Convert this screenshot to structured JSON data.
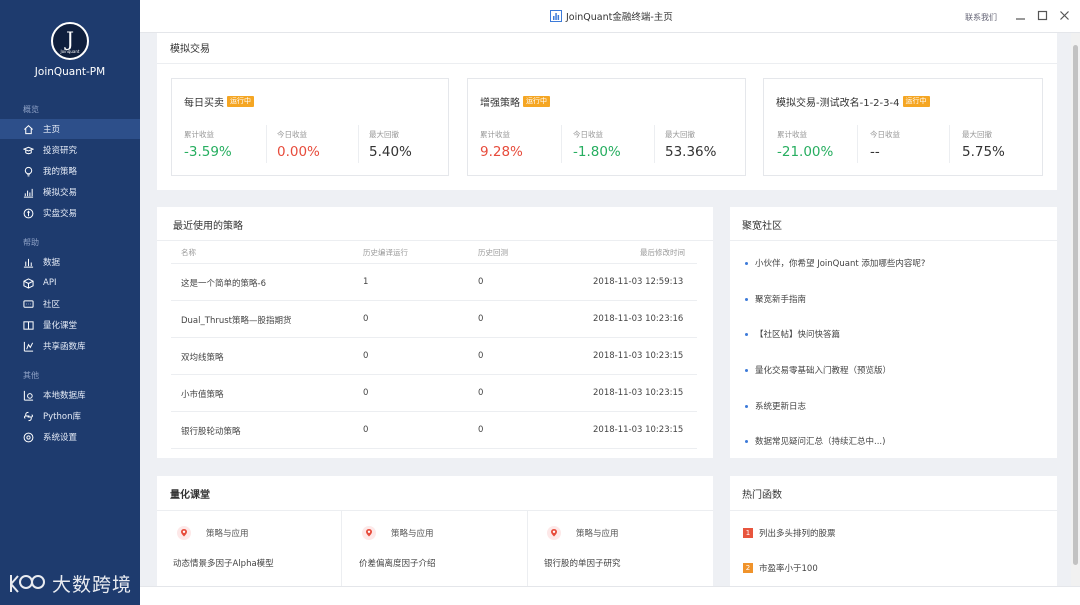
{
  "window": {
    "title": "JoinQuant金融终端-主页",
    "contact": "联系我们"
  },
  "sidebar": {
    "logo_letter": "J",
    "logo_sub": "Joinquant",
    "username": "JoinQuant-PM",
    "sections": [
      {
        "title": "概览",
        "items": [
          {
            "label": "主页",
            "icon": "home-icon"
          },
          {
            "label": "投资研究",
            "icon": "graduation-cap-icon"
          },
          {
            "label": "我的策略",
            "icon": "bulb-icon"
          },
          {
            "label": "模拟交易",
            "icon": "bar-chart-icon"
          },
          {
            "label": "实盘交易",
            "icon": "coin-icon"
          }
        ]
      },
      {
        "title": "帮助",
        "items": [
          {
            "label": "数据",
            "icon": "data-chart-icon"
          },
          {
            "label": "API",
            "icon": "cube-icon"
          },
          {
            "label": "社区",
            "icon": "chat-icon"
          },
          {
            "label": "量化课堂",
            "icon": "book-icon"
          },
          {
            "label": "共享函数库",
            "icon": "function-icon"
          }
        ]
      },
      {
        "title": "其他",
        "items": [
          {
            "label": "本地数据库",
            "icon": "database-icon"
          },
          {
            "label": "Python库",
            "icon": "python-icon"
          },
          {
            "label": "系统设置",
            "icon": "settings-icon"
          }
        ]
      }
    ],
    "watermark": "大数跨境"
  },
  "sim": {
    "title": "模拟交易",
    "cards": [
      {
        "name": "每日买卖",
        "status": "运行中",
        "metrics": [
          {
            "label": "累计收益",
            "value": "-3.59%",
            "color": "green"
          },
          {
            "label": "今日收益",
            "value": "0.00%",
            "color": "red"
          },
          {
            "label": "最大回撤",
            "value": "5.40%",
            "color": "dark"
          }
        ]
      },
      {
        "name": "增强策略",
        "status": "运行中",
        "metrics": [
          {
            "label": "累计收益",
            "value": "9.28%",
            "color": "red"
          },
          {
            "label": "今日收益",
            "value": "-1.80%",
            "color": "green"
          },
          {
            "label": "最大回撤",
            "value": "53.36%",
            "color": "dark"
          }
        ]
      },
      {
        "name": "模拟交易-测试改名-1-2-3-4",
        "status": "运行中",
        "metrics": [
          {
            "label": "累计收益",
            "value": "-21.00%",
            "color": "green"
          },
          {
            "label": "今日收益",
            "value": "--",
            "color": "dark"
          },
          {
            "label": "最大回撤",
            "value": "5.75%",
            "color": "dark"
          }
        ]
      }
    ]
  },
  "recent": {
    "title": "最近使用的策略",
    "headers": [
      "名称",
      "历史编译运行",
      "历史回测",
      "最后修改时间"
    ],
    "rows": [
      [
        "这是一个简单的策略-6",
        "1",
        "0",
        "2018-11-03 12:59:13"
      ],
      [
        "Dual_Thrust策略—股指期货",
        "0",
        "0",
        "2018-11-03 10:23:16"
      ],
      [
        "双均线策略",
        "0",
        "0",
        "2018-11-03 10:23:15"
      ],
      [
        "小市值策略",
        "0",
        "0",
        "2018-11-03 10:23:15"
      ],
      [
        "银行股轮动策略",
        "0",
        "0",
        "2018-11-03 10:23:15"
      ]
    ]
  },
  "community": {
    "title": "聚宽社区",
    "items": [
      "小伙伴，你希望 JoinQuant 添加哪些内容呢?",
      "聚宽新手指南",
      "【社区帖】快问快答篇",
      "量化交易零基础入门教程（预览版）",
      "系统更新日志",
      "数据常见疑问汇总（持续汇总中...)"
    ]
  },
  "course": {
    "title": "量化课堂",
    "items": [
      {
        "tag": "策略与应用",
        "title": "动态情景多因子Alpha模型"
      },
      {
        "tag": "策略与应用",
        "title": "价差偏离度因子介绍"
      },
      {
        "tag": "策略与应用",
        "title": "银行股的单因子研究"
      }
    ]
  },
  "hot": {
    "title": "热门函数",
    "items": [
      {
        "num": "1",
        "label": "列出多头排列的股票",
        "color": "#e8553e"
      },
      {
        "num": "2",
        "label": "市盈率小于100",
        "color": "#f0932b"
      }
    ]
  },
  "colors": {
    "sidebar": "#1e3b6e",
    "accent_blue": "#3d7bd9",
    "badge": "#f5a623",
    "positive_red": "#e74c3c",
    "negative_green": "#27ae60"
  }
}
